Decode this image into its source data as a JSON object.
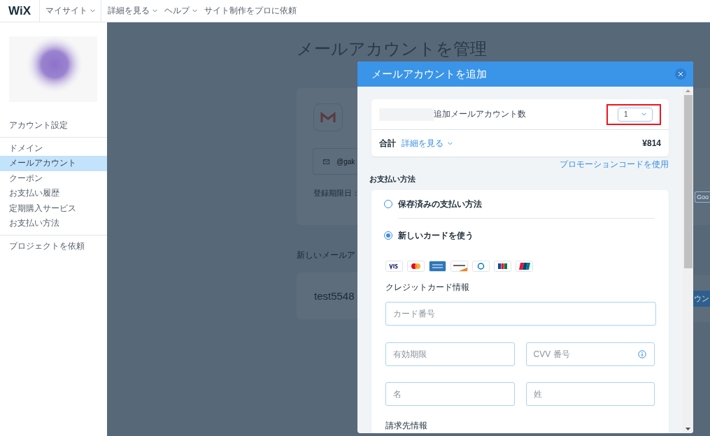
{
  "header": {
    "logo": "WiX",
    "nav": [
      {
        "label": "マイサイト",
        "has_menu": true,
        "separated": true
      },
      {
        "label": "詳細を見る",
        "has_menu": true,
        "separated": false
      },
      {
        "label": "ヘルプ",
        "has_menu": true,
        "separated": false
      },
      {
        "label": "サイト制作をプロに依頼",
        "has_menu": false,
        "separated": false
      }
    ]
  },
  "sidebar": {
    "groups": [
      {
        "items": [
          {
            "label": "アカウント設定",
            "selected": false
          }
        ]
      },
      {
        "items": [
          {
            "label": "ドメイン",
            "selected": false
          },
          {
            "label": "メールアカウント",
            "selected": true
          },
          {
            "label": "クーポン",
            "selected": false
          },
          {
            "label": "お支払い履歴",
            "selected": false
          },
          {
            "label": "定期購入サービス",
            "selected": false
          },
          {
            "label": "お支払い方法",
            "selected": false
          }
        ]
      },
      {
        "items": [
          {
            "label": "プロジェクトを依頼",
            "selected": false
          }
        ]
      }
    ]
  },
  "page": {
    "title": "メールアカウントを管理",
    "mailbox_field": "@gak",
    "expiry_label": "登録期限日：",
    "right_button": "Goo",
    "new_section_label": "新しいメールア",
    "new_account": "test5548",
    "new_account_button": "ウン"
  },
  "modal": {
    "title": "メールアカウントを追加",
    "quantity_label": "追加メールアカウント数",
    "quantity": {
      "value": "1",
      "highlighted": true
    },
    "total_label": "合計",
    "details_link": "詳細を見る",
    "total": "¥814",
    "promo_link": "プロモーションコードを使用",
    "payment_label": "お支払い方法",
    "payment_options": [
      {
        "label": "保存済みの支払い方法",
        "selected": false
      },
      {
        "label": "新しいカードを使う",
        "selected": true
      }
    ],
    "card_section": "クレジットカード情報",
    "fields": [
      {
        "placeholder": "カード番号",
        "kind": "full"
      },
      {
        "placeholder": "有効期限",
        "kind": "half"
      },
      {
        "placeholder": "CVV 番号",
        "kind": "info"
      },
      {
        "placeholder": "名",
        "kind": "half"
      },
      {
        "placeholder": "姓",
        "kind": "half"
      }
    ],
    "billing_section": "請求先情報"
  }
}
